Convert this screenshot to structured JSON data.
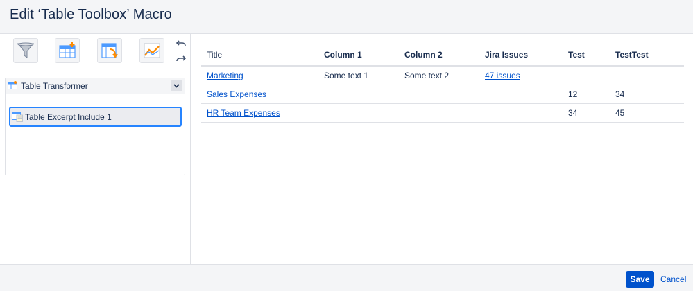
{
  "header": {
    "title": "Edit ‘Table Toolbox’ Macro"
  },
  "toolbar": {
    "tools": [
      {
        "icon": "filter-funnel-icon"
      },
      {
        "icon": "table-add-column-icon"
      },
      {
        "icon": "table-pivot-icon"
      },
      {
        "icon": "chart-line-icon"
      }
    ],
    "undo_icon": "undo-icon",
    "redo_icon": "redo-icon"
  },
  "macro_tree": {
    "parent_label": "Table Transformer",
    "child_label": "Table Excerpt Include 1"
  },
  "table": {
    "columns": [
      "Title",
      "Column 1",
      "Column 2",
      "Jira Issues",
      "Test",
      "TestTest"
    ],
    "rows": [
      [
        "Marketing",
        "Some text 1",
        "Some text 2",
        "47 issues",
        "",
        ""
      ],
      [
        "Sales Expenses",
        "",
        "",
        "",
        "12",
        "34"
      ],
      [
        "HR Team Expenses",
        "",
        "",
        "",
        "34",
        "45"
      ]
    ]
  },
  "footer": {
    "save_label": "Save",
    "cancel_label": "Cancel"
  },
  "colors": {
    "accent": "#0052cc",
    "focus": "#2684ff",
    "panel": "#f4f5f7",
    "border": "#dfe1e6",
    "text": "#172b4d"
  }
}
